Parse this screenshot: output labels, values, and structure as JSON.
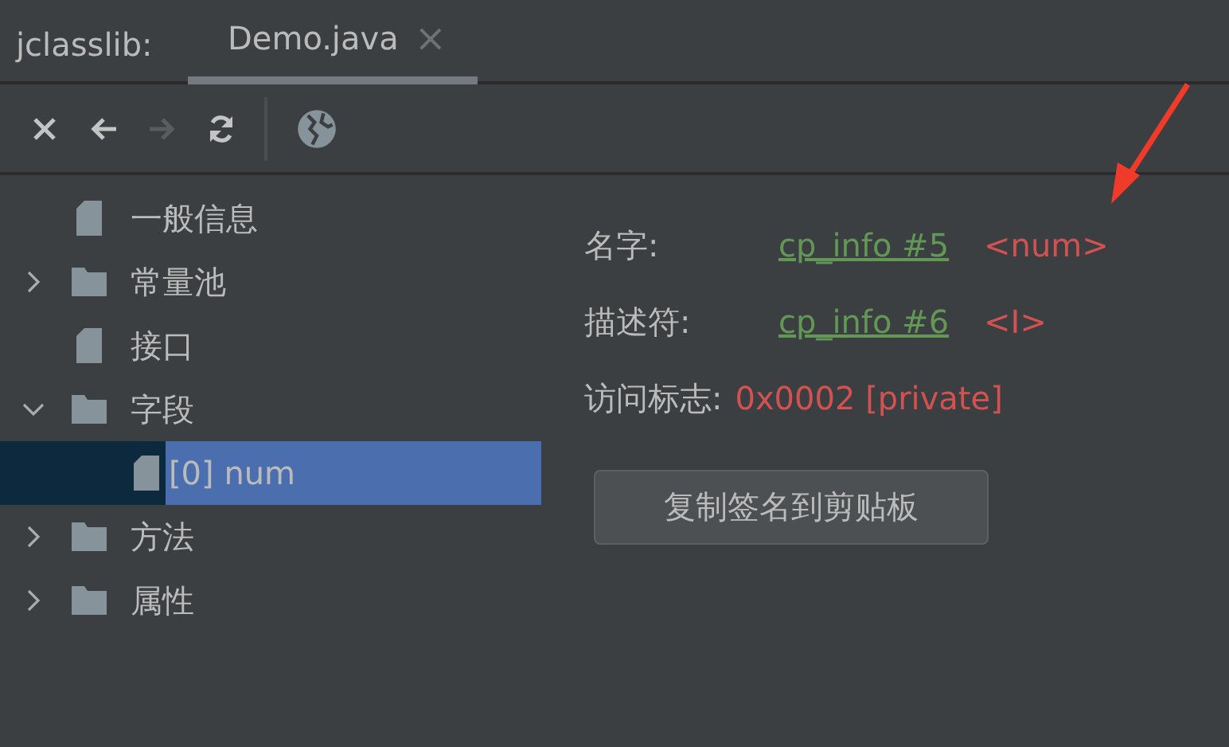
{
  "header": {
    "label": "jclasslib:",
    "tabs": [
      {
        "label": "Demo.java",
        "close": "×",
        "selected": true
      }
    ]
  },
  "toolbar": [
    {
      "kind": "close",
      "disabled": false
    },
    {
      "kind": "back",
      "disabled": false
    },
    {
      "kind": "forward",
      "disabled": true
    },
    {
      "kind": "refresh",
      "disabled": false
    },
    {
      "kind": "separator"
    },
    {
      "kind": "web",
      "disabled": false
    }
  ],
  "tree": [
    {
      "label": "一般信息",
      "kind": "file",
      "selected": false
    },
    {
      "label": "常量池",
      "kind": "folder",
      "expanded": false,
      "selected": false
    },
    {
      "label": "接口",
      "kind": "file",
      "selected": false
    },
    {
      "label": "字段",
      "kind": "folder",
      "expanded": true,
      "selected": false,
      "children": [
        {
          "label": "[0] num",
          "kind": "file",
          "selected": true
        }
      ]
    },
    {
      "label": "方法",
      "kind": "folder",
      "expanded": false,
      "selected": false
    },
    {
      "label": "属性",
      "kind": "folder",
      "expanded": false,
      "selected": false
    }
  ],
  "details": [
    {
      "label": "名字:",
      "kind": "link",
      "link": "cp_info #5",
      "value": "<num>"
    },
    {
      "label": "描述符:",
      "kind": "link",
      "link": "cp_info #6",
      "value": "<I>"
    },
    {
      "label": "访问标志:",
      "kind": "plain",
      "value": "0x0002 [private]"
    }
  ],
  "button": "复制签名到剪贴板"
}
